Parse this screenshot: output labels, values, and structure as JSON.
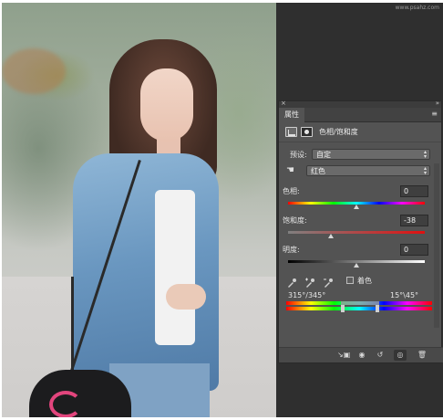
{
  "watermark": "www.psahz.com",
  "panel": {
    "tab_label": "属性",
    "close_glyph": "×",
    "collapse_glyph": "»",
    "menu_glyph": "≡",
    "adjustment_title": "色相/饱和度",
    "preset_label": "预设:",
    "preset_value": "自定",
    "channel_value": "红色",
    "hue_label": "色相:",
    "hue_value": "0",
    "saturation_label": "饱和度:",
    "saturation_value": "-38",
    "lightness_label": "明度:",
    "lightness_value": "0",
    "colorize_label": "着色",
    "colorize_checked": false,
    "range_left_label": "315°/345°",
    "range_right_label": "15°\\45°",
    "hue_level": 0,
    "saturation_level": -38,
    "lightness_level": 0,
    "footer_buttons": [
      "clip-to-layer-icon",
      "view-previous-icon",
      "reset-icon",
      "visibility-eye-icon",
      "trash-icon"
    ]
  },
  "colors": {
    "panel_bg": "#535353",
    "workspace_bg": "#2f2f2f",
    "tab_bg": "#424242"
  }
}
